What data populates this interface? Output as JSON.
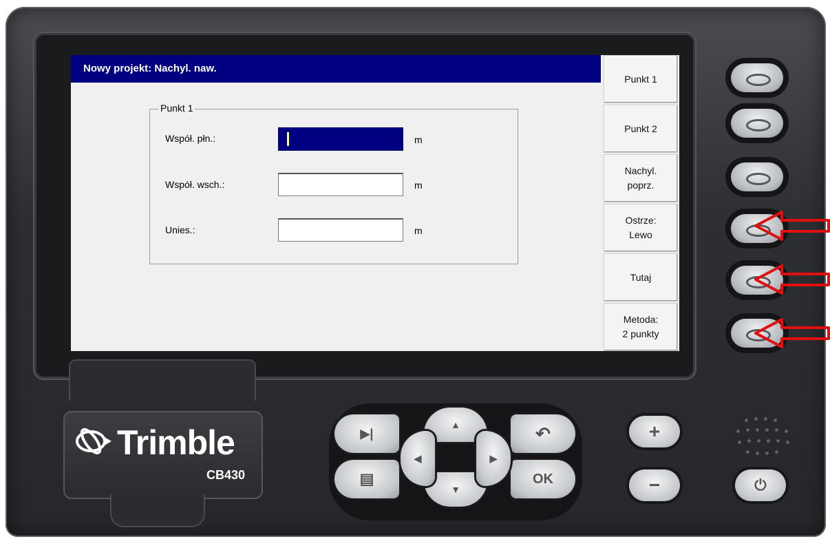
{
  "screen": {
    "title": "Nowy projekt: Nachyl. naw."
  },
  "group": {
    "legend": "Punkt 1",
    "fields": [
      {
        "label": "Współ. płn.:",
        "value": "",
        "unit": "m",
        "active": true
      },
      {
        "label": "Współ. wsch.:",
        "value": "",
        "unit": "m",
        "active": false
      },
      {
        "label": "Unies.:",
        "value": "",
        "unit": "m",
        "active": false
      }
    ]
  },
  "softkeys": [
    {
      "label": "Punkt 1"
    },
    {
      "label": "Punkt 2"
    },
    {
      "label": "Nachyl.\npoprz."
    },
    {
      "label": "Ostrze:\nLewo"
    },
    {
      "label": "Tutaj"
    },
    {
      "label": "Metoda:\n2 punkty"
    }
  ],
  "device": {
    "brand": "Trimble",
    "model": "CB430",
    "ok_key": "OK",
    "plus_key": "+",
    "minus_key": "−"
  },
  "annotations": {
    "arrow_color": "#e01010",
    "highlighted_softkeys": [
      "Ostrze:\nLewo",
      "Tutaj",
      "Metoda:\n2 punkty"
    ]
  },
  "colors": {
    "titlebar": "#000080",
    "active_field": "#000080",
    "caret": "#ffff88"
  }
}
